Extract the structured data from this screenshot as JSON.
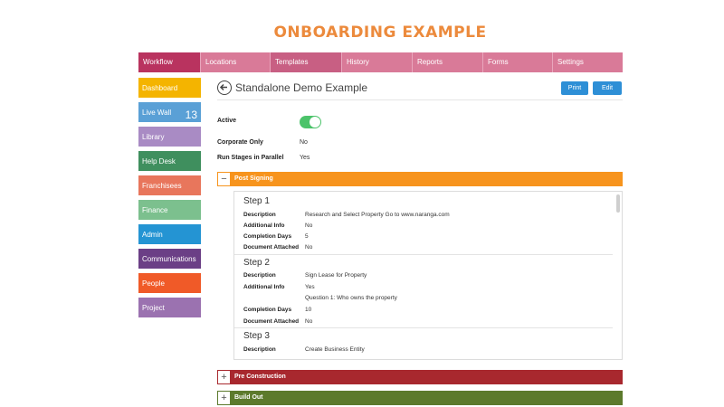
{
  "page": {
    "title": "ONBOARDING  EXAMPLE"
  },
  "topnav": {
    "items": [
      {
        "label": "Workflow",
        "width": 68
      },
      {
        "label": "Locations",
        "width": 77
      },
      {
        "label": "Templates",
        "width": 79
      },
      {
        "label": "History",
        "width": 78
      },
      {
        "label": "Reports",
        "width": 78
      },
      {
        "label": "Forms",
        "width": 77
      },
      {
        "label": "Settings",
        "width": 78
      }
    ]
  },
  "sidebar": {
    "items": [
      {
        "label": "Dashboard",
        "color": "#f4b400"
      },
      {
        "label": "Live Wall",
        "count": "13",
        "color": "#5aa0d6"
      },
      {
        "label": "Library",
        "color": "#a98bc4"
      },
      {
        "label": "Help Desk",
        "color": "#3f8f5e"
      },
      {
        "label": "Franchisees",
        "color": "#e8765c"
      },
      {
        "label": "Finance",
        "color": "#7cc08e"
      },
      {
        "label": "Admin",
        "color": "#2494d3"
      },
      {
        "label": "Communications",
        "color": "#6b3f86"
      },
      {
        "label": "People",
        "color": "#f05a28"
      },
      {
        "label": "Project",
        "color": "#9b72b0"
      }
    ]
  },
  "workflow": {
    "title": "Standalone Demo Example",
    "print_label": "Print",
    "edit_label": "Edit",
    "active_label": "Active",
    "active_on": true,
    "corporate_label": "Corporate Only",
    "corporate_value": "No",
    "parallel_label": "Run Stages in Parallel",
    "parallel_value": "Yes"
  },
  "stages": [
    {
      "name": "Post Signing",
      "toggle": "−",
      "color": "#f7941d",
      "expanded": true
    },
    {
      "name": "Pre Construction",
      "toggle": "+",
      "color": "#a8282e",
      "expanded": false
    },
    {
      "name": "Build Out",
      "toggle": "+",
      "color": "#5c7a2c",
      "expanded": false
    }
  ],
  "steps": [
    {
      "title": "Step 1",
      "rows": [
        {
          "label": "Description",
          "value": "Research and Select Property Go to www.naranga.com"
        },
        {
          "label": "Additional Info",
          "value": "No"
        },
        {
          "label": "Completion Days",
          "value": "5"
        },
        {
          "label": "Document Attached",
          "value": "No"
        }
      ]
    },
    {
      "title": "Step 2",
      "rows": [
        {
          "label": "Description",
          "value": "Sign Lease for Property"
        },
        {
          "label": "Additional Info",
          "value": "Yes"
        },
        {
          "label": "",
          "value": "Question 1: Who owns the property"
        },
        {
          "label": "Completion Days",
          "value": "10"
        },
        {
          "label": "Document Attached",
          "value": "No"
        }
      ]
    },
    {
      "title": "Step 3",
      "rows": [
        {
          "label": "Description",
          "value": "Create Business Entity"
        }
      ]
    }
  ]
}
